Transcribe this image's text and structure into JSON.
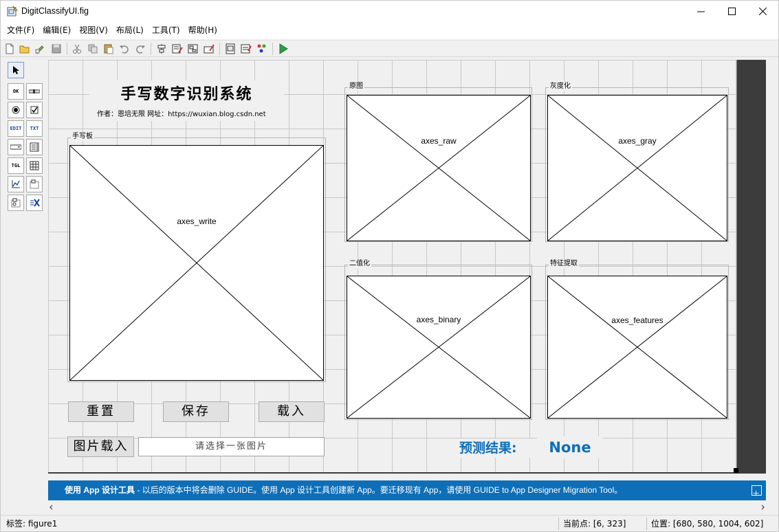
{
  "window": {
    "title": "DigitClassifyUI.fig"
  },
  "menu": [
    "文件(F)",
    "编辑(E)",
    "视图(V)",
    "布局(L)",
    "工具(T)",
    "帮助(H)"
  ],
  "palette_labels": {
    "ok": "OK",
    "edit": "EDIT",
    "text": "TXT",
    "toggle": "TGL"
  },
  "canvas": {
    "title": "手写数字识别系统",
    "author": "作者：恩培无限  网址：https://wuxian.blog.csdn.net",
    "panels": {
      "write": {
        "title": "手写板",
        "axes": "axes_write"
      },
      "raw": {
        "title": "原图",
        "axes": "axes_raw"
      },
      "gray": {
        "title": "灰度化",
        "axes": "axes_gray"
      },
      "binary": {
        "title": "二值化",
        "axes": "axes_binary"
      },
      "features": {
        "title": "特征提取",
        "axes": "axes_features"
      }
    },
    "buttons": {
      "reset": "重置",
      "save": "保存",
      "load": "载入",
      "load_image": "图片载入"
    },
    "image_input": {
      "value": "请选择一张图片"
    },
    "result": {
      "label": "预测结果:",
      "value": "None"
    }
  },
  "infobar": {
    "bold": "使用 App 设计工具",
    "text": " - 以后的版本中将会删除 GUIDE。使用 App 设计工具创建新 App。要迁移现有 App，请使用 GUIDE to App Designer Migration Tool。"
  },
  "status": {
    "tag": "标签: figure1",
    "current_point": "当前点:  [6, 323]",
    "position": "位置: [680, 580, 1004, 602]"
  },
  "colors": {
    "accent": "#0e6fb8",
    "infobar": "#0e6fb8"
  }
}
